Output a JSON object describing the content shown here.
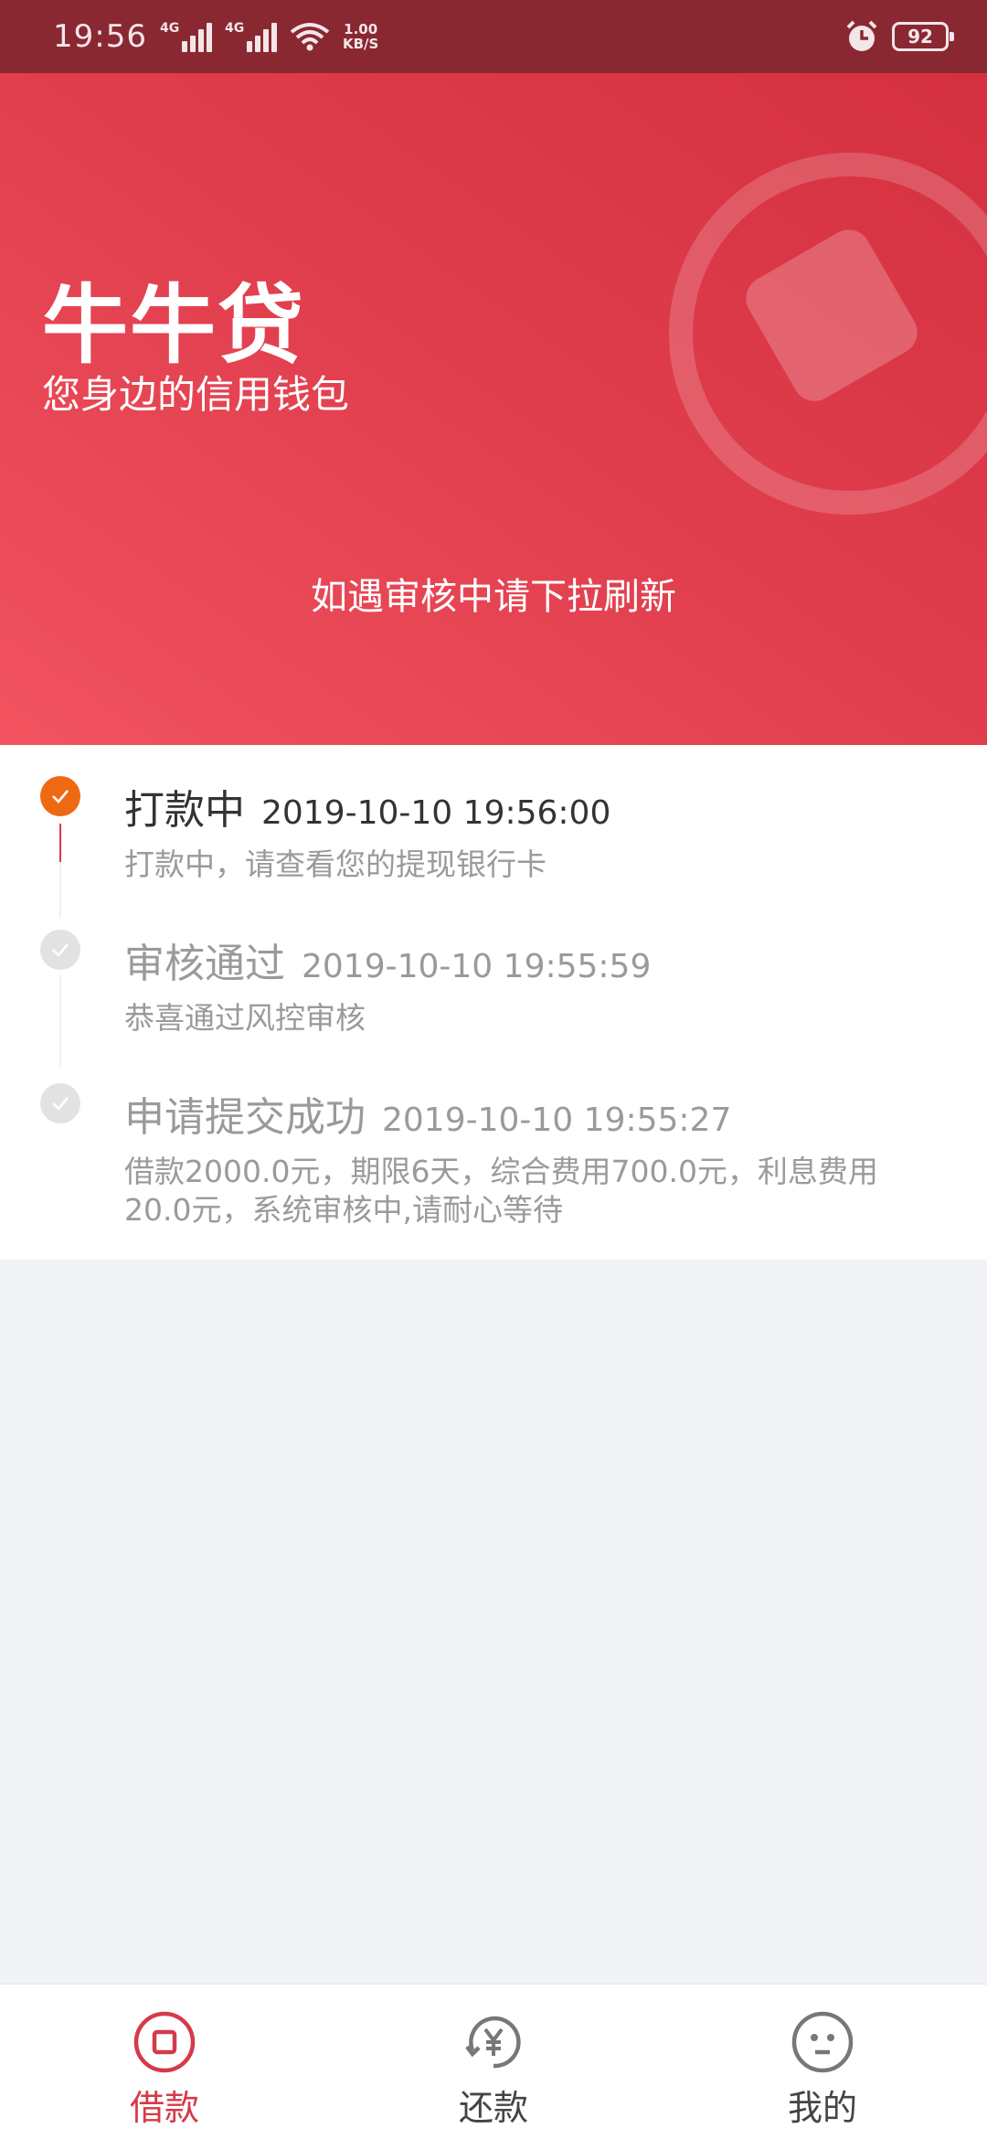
{
  "status_bar": {
    "time": "19:56",
    "signal1_tag": "4G",
    "signal2_tag": "4G",
    "speed_value": "1.00",
    "speed_unit": "KB/S",
    "battery": "92",
    "icons": [
      "signal-icon",
      "wifi-icon",
      "alarm-icon",
      "battery-icon"
    ]
  },
  "banner": {
    "title": "牛牛贷",
    "subtitle": "您身边的信用钱包",
    "hint": "如遇审核中请下拉刷新"
  },
  "timeline": {
    "steps": [
      {
        "title": "打款中",
        "time": "2019-10-10 19:56:00",
        "desc": "打款中，请查看您的提现银行卡",
        "state": "active"
      },
      {
        "title": "审核通过",
        "time": "2019-10-10 19:55:59",
        "desc": "恭喜通过风控审核",
        "state": "done"
      },
      {
        "title": "申请提交成功",
        "time": "2019-10-10 19:55:27",
        "desc": "借款2000.0元，期限6天，综合费用700.0元，利息费用20.0元，系统审核中,请耐心等待",
        "state": "done"
      }
    ]
  },
  "bottom_nav": {
    "items": [
      {
        "label": "借款",
        "icon": "borrow-icon",
        "active": true
      },
      {
        "label": "还款",
        "icon": "repay-yen-icon",
        "active": false
      },
      {
        "label": "我的",
        "icon": "profile-face-icon",
        "active": false
      }
    ]
  },
  "colors": {
    "status_bar": "#8a2832",
    "brand_red": "#e2404f",
    "active_orange": "#ee6a12",
    "nav_active": "#d53a48",
    "page_bg": "#f2f3f7"
  }
}
